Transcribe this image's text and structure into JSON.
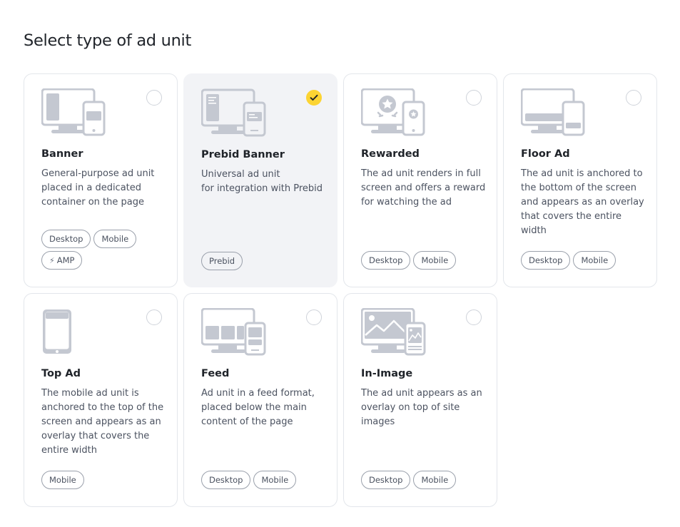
{
  "page": {
    "title": "Select type of ad unit"
  },
  "cards": [
    {
      "title": "Banner",
      "desc_lines": [
        "General-purpose ad unit",
        "placed in a dedicated",
        "container on the page"
      ],
      "tags": [
        "Desktop",
        "Mobile",
        "AMP"
      ],
      "selected": false
    },
    {
      "title": "Prebid Banner",
      "desc_lines": [
        "Universal ad unit",
        "for integration with Prebid"
      ],
      "tags": [
        "Prebid"
      ],
      "selected": true
    },
    {
      "title": "Rewarded",
      "desc_lines": [
        "The ad unit renders in full",
        "screen and offers a reward",
        "for watching the ad"
      ],
      "tags": [
        "Desktop",
        "Mobile"
      ],
      "selected": false
    },
    {
      "title": "Floor Ad",
      "desc_lines": [
        "The ad unit is anchored to",
        "the bottom of the screen",
        "and appears as an overlay",
        "that covers the entire",
        "width"
      ],
      "tags": [
        "Desktop",
        "Mobile"
      ],
      "selected": false
    },
    {
      "title": "Top Ad",
      "desc_lines": [
        "The mobile ad unit is",
        "anchored to the top of the",
        "screen and appears as an",
        "overlay that covers the",
        "entire width"
      ],
      "tags": [
        "Mobile"
      ],
      "selected": false
    },
    {
      "title": "Feed",
      "desc_lines": [
        "Ad unit in a feed format,",
        "placed below the main",
        "content of the page"
      ],
      "tags": [
        "Desktop",
        "Mobile"
      ],
      "selected": false
    },
    {
      "title": "In-Image",
      "desc_lines": [
        "The ad unit appears as an",
        "overlay on top of site",
        "images"
      ],
      "tags": [
        "Desktop",
        "Mobile"
      ],
      "selected": false
    }
  ],
  "colors": {
    "selected_bg": "#f2f3f6",
    "check_yellow": "#fcd433",
    "illustration": "#c4c8d1",
    "border": "#e3e6eb"
  }
}
